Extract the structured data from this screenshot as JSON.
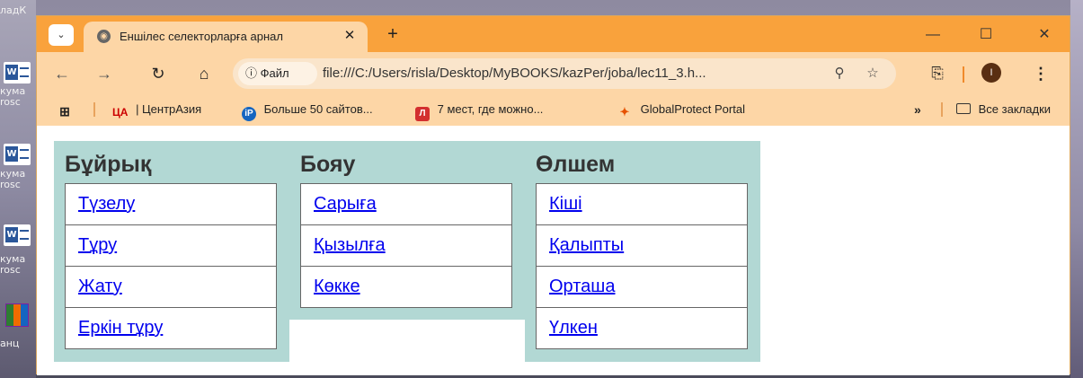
{
  "desktop": {
    "labels": [
      "ладК",
      "кума",
      "rosc",
      "кума",
      "rosc",
      "кума",
      "rosc",
      "анц"
    ]
  },
  "browser": {
    "tab": {
      "title": "Еншілес селекторларға арнал"
    },
    "address": {
      "file_chip": "Файл",
      "url": "file:///C:/Users/risla/Desktop/MyBOOKS/kazPer/joba/lec11_3.h..."
    },
    "profile_initial": "I",
    "bookmarks": [
      {
        "icon": "ca-icon",
        "label": "| ЦентрАзия",
        "prefix": "ЦА"
      },
      {
        "icon": "ip-icon",
        "label": "Больше 50 сайтов..."
      },
      {
        "icon": "l-icon",
        "label": "7 мест, где можно..."
      },
      {
        "icon": "globalprotect-icon",
        "label": "GlobalProtect Portal"
      }
    ],
    "all_bookmarks_label": "Все закладки"
  },
  "page": {
    "columns": [
      {
        "heading": "Бұйрық",
        "links": [
          "Түзелу",
          "Тұру",
          "Жату",
          "Еркін тұру"
        ]
      },
      {
        "heading": "Бояу",
        "links": [
          "Сарыға",
          "Қызылға",
          "Көкке"
        ]
      },
      {
        "heading": "Өлшем",
        "links": [
          "Кіші",
          "Қалыпты",
          "Орташа",
          "Үлкен"
        ]
      }
    ],
    "colors": {
      "column_bg": "#b2d8d4",
      "link": "#0000ee",
      "titlebar": "#f9a23c",
      "toolbar": "#fdd6a6"
    }
  }
}
